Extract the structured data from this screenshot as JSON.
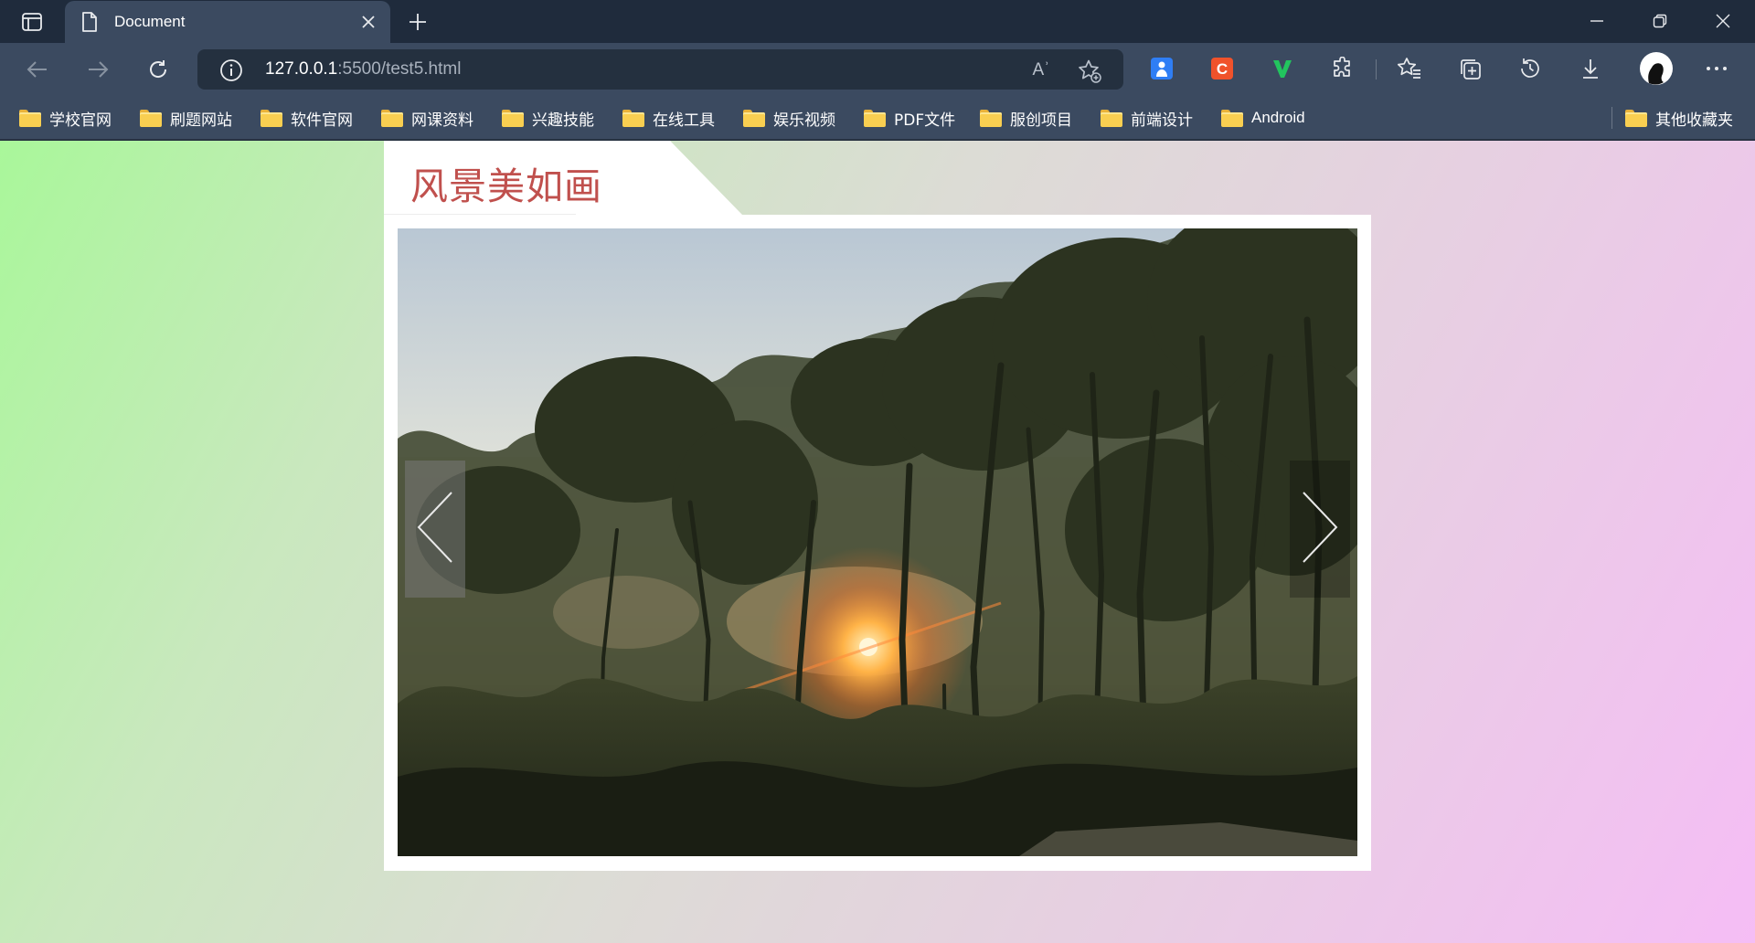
{
  "browser": {
    "tab": {
      "title": "Document"
    },
    "address_bar": {
      "url_host": "127.0.0.1",
      "url_path": ":5500/test5.html"
    },
    "read_aloud_glyph": "Aʾ",
    "icons": {
      "tab_actions": "tab-actions-icon",
      "tab_close": "close-icon",
      "new_tab": "plus-icon",
      "minimize": "minimize-icon",
      "restore": "restore-icon",
      "close_window": "close-icon",
      "back": "arrow-left-icon",
      "forward": "arrow-right-icon",
      "refresh": "refresh-icon",
      "site_info": "info-icon",
      "read_aloud": "read-aloud-icon",
      "add_favorite": "star-plus-icon",
      "extensions": "puzzle-icon",
      "favorites": "favorites-icon",
      "collections": "collections-icon",
      "history": "history-icon",
      "downloads": "download-icon",
      "profile": "avatar",
      "more": "more-icon"
    },
    "extensions": [
      {
        "name": "extension-blue",
        "letter": "",
        "color": "#2f7ef5"
      },
      {
        "name": "extension-c",
        "letter": "C",
        "color": "#f0522b"
      },
      {
        "name": "extension-v",
        "letter": "V",
        "color": "#22c55e"
      }
    ]
  },
  "bookmarks": {
    "items": [
      {
        "label": "学校官网"
      },
      {
        "label": "刷题网站"
      },
      {
        "label": "软件官网"
      },
      {
        "label": "网课资料"
      },
      {
        "label": "兴趣技能"
      },
      {
        "label": "在线工具"
      },
      {
        "label": "娱乐视频"
      },
      {
        "label": "PDF文件"
      },
      {
        "label": "服创项目"
      },
      {
        "label": "前端设计"
      },
      {
        "label": "Android"
      }
    ],
    "other": {
      "label": "其他收藏夹"
    }
  },
  "page": {
    "title": "风景美如画",
    "title_color": "#c0504d",
    "background_gradient": [
      "#a9f79a",
      "#dcdcd5",
      "#f5bdf5"
    ],
    "slider": {
      "image": "sunset-forest-photo",
      "prev_icon": "chevron-left-icon",
      "next_icon": "chevron-right-icon"
    }
  }
}
